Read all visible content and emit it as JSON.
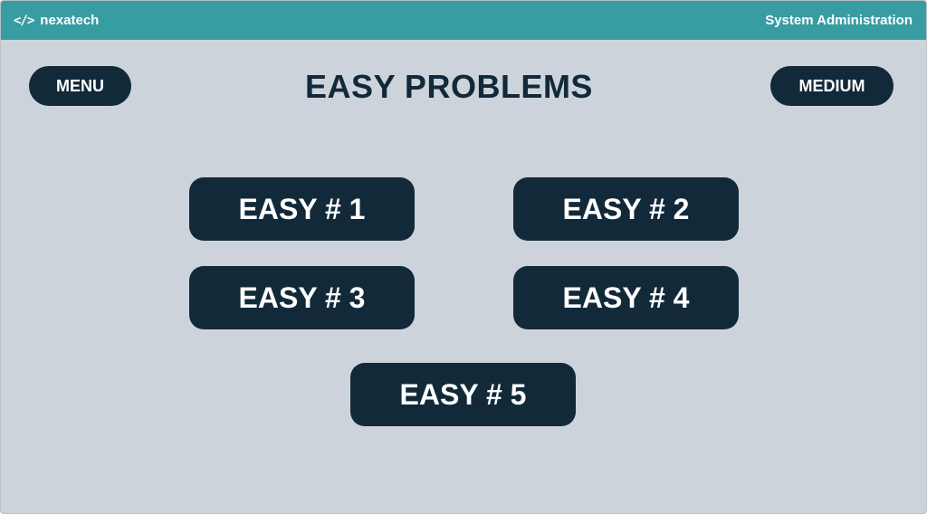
{
  "header": {
    "brand_icon": "</>",
    "brand_name": "nexatech",
    "section": "System Administration"
  },
  "nav": {
    "menu_label": "MENU",
    "medium_label": "MEDIUM"
  },
  "page": {
    "title": "EASY PROBLEMS"
  },
  "problems": [
    {
      "label": "EASY # 1"
    },
    {
      "label": "EASY # 2"
    },
    {
      "label": "EASY # 3"
    },
    {
      "label": "EASY # 4"
    },
    {
      "label": "EASY # 5"
    }
  ],
  "colors": {
    "topbar": "#379da3",
    "background": "#ccd3da",
    "button": "#12293a",
    "button_text": "#ffffff"
  }
}
